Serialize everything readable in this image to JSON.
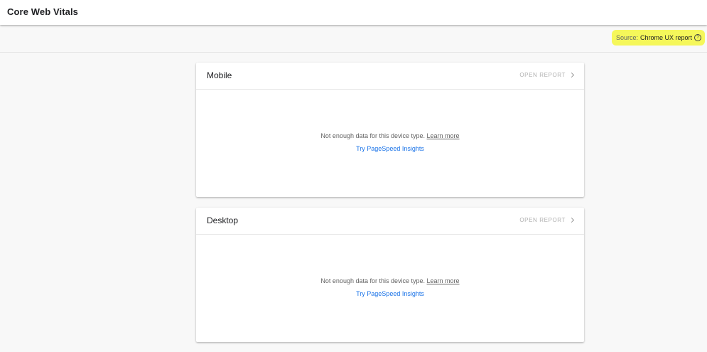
{
  "header": {
    "title": "Core Web Vitals"
  },
  "source": {
    "label": "Source:",
    "link": "Chrome UX report",
    "help_icon": "help-circle-icon",
    "highlight_color": "#f5f75a"
  },
  "cards": [
    {
      "title": "Mobile",
      "open_report": "OPEN REPORT",
      "message": "Not enough data for this device type.",
      "learn_more": "Learn more",
      "psi_link": "Try PageSpeed Insights"
    },
    {
      "title": "Desktop",
      "open_report": "OPEN REPORT",
      "message": "Not enough data for this device type.",
      "learn_more": "Learn more",
      "psi_link": "Try PageSpeed Insights"
    }
  ],
  "colors": {
    "link_blue": "#1a73e8",
    "muted_text": "#b0b0b0"
  }
}
